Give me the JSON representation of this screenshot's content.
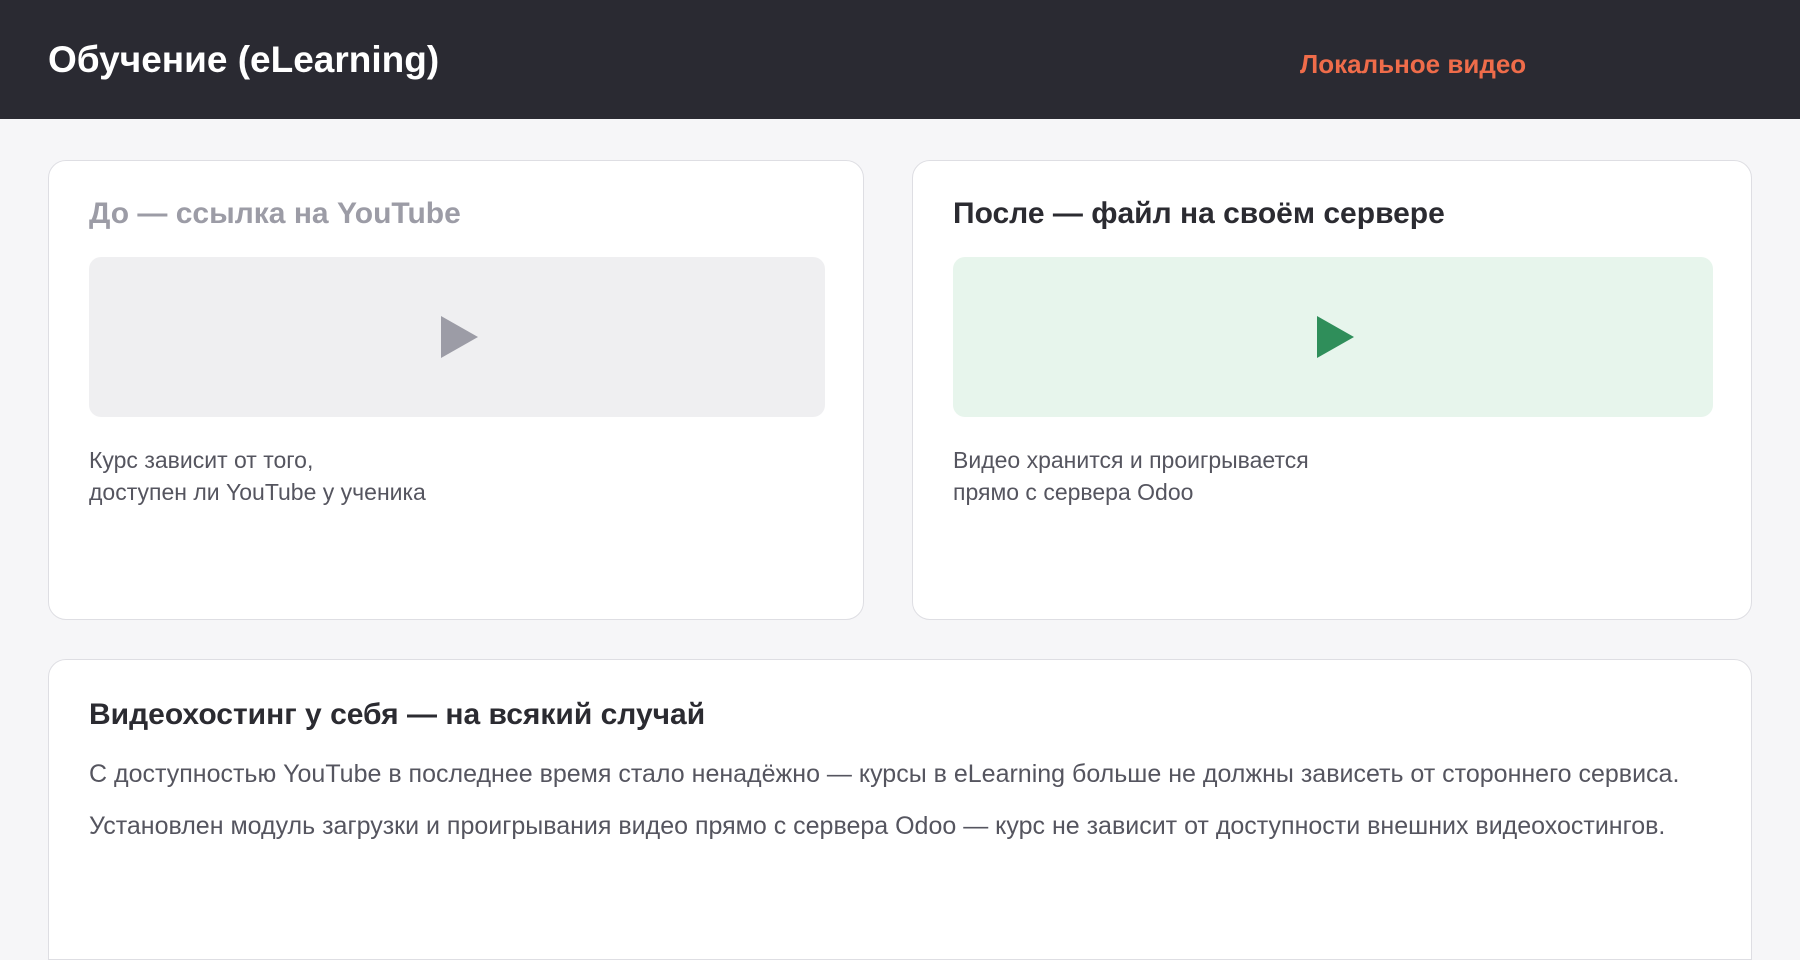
{
  "header": {
    "title": "Обучение (eLearning)",
    "tag": "Локальное видео"
  },
  "before": {
    "title": "До — ссылка на YouTube",
    "line1": "Курс зависит от того,",
    "line2": "доступен ли YouTube у ученика",
    "icon": "play-icon",
    "accent": "#9c9ca6"
  },
  "after": {
    "title": "После — файл на своём сервере",
    "line1": "Видео хранится и проигрывается",
    "line2": "прямо с сервера Odoo",
    "icon": "play-icon",
    "accent": "#2f8e5a"
  },
  "info": {
    "title": "Видеохостинг у себя — на всякий случай",
    "p1": "С доступностью YouTube в последнее время стало ненадёжно — курсы в eLearning больше не должны зависеть от стороннего сервиса.",
    "p2": "Установлен модуль загрузки и проигрывания видео прямо с сервера Odoo — курс не зависит от доступности внешних видеохостингов."
  },
  "colors": {
    "header_bg": "#2a2a32",
    "tag": "#ef6c4a",
    "page_bg": "#f6f6f8"
  }
}
